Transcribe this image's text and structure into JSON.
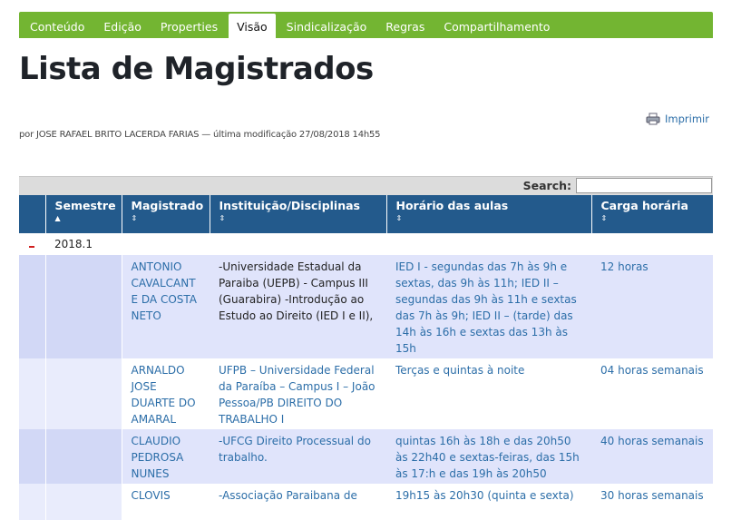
{
  "tabs": [
    {
      "label": "Conteúdo"
    },
    {
      "label": "Edição"
    },
    {
      "label": "Properties"
    },
    {
      "label": "Visão"
    },
    {
      "label": "Sindicalização"
    },
    {
      "label": "Regras"
    },
    {
      "label": "Compartilhamento"
    }
  ],
  "page": {
    "title": "Lista de Magistrados",
    "byline": "por JOSE RAFAEL BRITO LACERDA FARIAS — última modificação 27/08/2018 14h55",
    "print_label": "Imprimir"
  },
  "search": {
    "label": "Search:",
    "value": ""
  },
  "table": {
    "headers": {
      "semestre": "Semestre",
      "semestre_sort": "▲",
      "magistrado": "Magistrado",
      "magistrado_sort": "⇕",
      "instituicao": "Instituição/Disciplinas",
      "instituicao_sort": "⇕",
      "horario": "Horário das aulas",
      "horario_sort": "⇕",
      "carga": "Carga horária",
      "carga_sort": "⇕"
    },
    "group": {
      "label": "2018.1"
    },
    "rows": [
      {
        "magistrado": "ANTONIO CAVALCANTE DA COSTA NETO",
        "instituicao": "-Universidade Estadual da Paraiba (UEPB) - Campus III (Guarabira) -Introdução ao Estudo ao Direito (IED I e II),",
        "horario": "IED I - segundas das 7h às 9h e sextas, das 9h às 11h; IED II – segundas das 9h às 11h e sextas das 7h às 9h; IED II – (tarde) das 14h às 16h e sextas das 13h às 15h",
        "carga": "12 horas"
      },
      {
        "magistrado": "ARNALDO JOSE DUARTE DO AMARAL",
        "instituicao": "UFPB – Universidade Federal da Paraíba – Campus I – João Pessoa/PB DIREITO DO TRABALHO I",
        "horario": "Terças e quintas à noite",
        "carga": "04 horas semanais"
      },
      {
        "magistrado": "CLAUDIO PEDROSA NUNES",
        "instituicao": "-UFCG Direito Processual do trabalho.",
        "horario": "quintas 16h às 18h e das 20h50 às 22h40 e sextas-feiras, das 15h às 17:h e das 19h às 20h50",
        "carga": "40 horas semanais"
      },
      {
        "magistrado": "CLOVIS",
        "instituicao": "-Associação Paraibana de",
        "horario": "19h15 às 20h30 (quinta e sexta)",
        "carga": "30 horas semanais"
      }
    ]
  }
}
